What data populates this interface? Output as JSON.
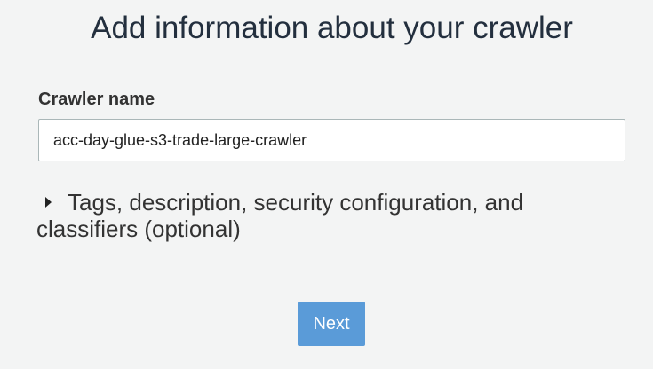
{
  "page": {
    "title": "Add information about your crawler"
  },
  "crawler_name": {
    "label": "Crawler name",
    "value": "acc-day-glue-s3-trade-large-crawler"
  },
  "optional_section": {
    "label": "Tags, description, security configuration, and classifiers (optional)",
    "expanded": false,
    "icon": "caret-right-icon"
  },
  "actions": {
    "next_label": "Next"
  },
  "colors": {
    "background": "#f3f4f4",
    "primary_button": "#5a9bd8",
    "input_border": "#aab7b8"
  }
}
